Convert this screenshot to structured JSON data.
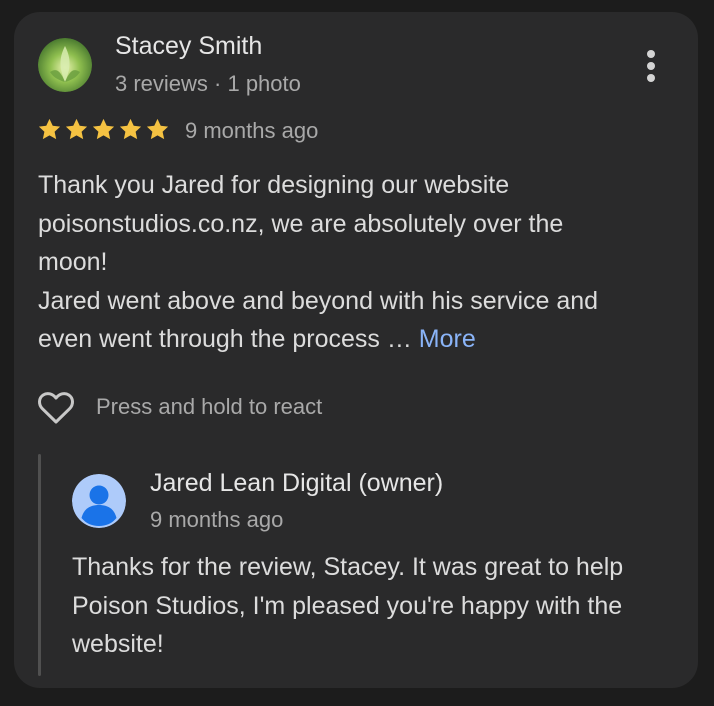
{
  "review": {
    "reviewer_name": "Stacey Smith",
    "reviewer_meta": "3 reviews · 1 photo",
    "rating": 5,
    "max_rating": 5,
    "time": "9 months ago",
    "text_lines": [
      "Thank you Jared for designing our website",
      "poisonstudios.co.nz, we are absolutely over the",
      "moon!",
      "Jared went above and beyond with his service and",
      "even went through the process … "
    ],
    "more_label": "More",
    "react_hint": "Press and hold to react",
    "colors": {
      "star": "#f5c242",
      "link": "#8ab4f8",
      "card_bg": "#2a2a2b"
    }
  },
  "reply": {
    "owner_name": "Jared Lean Digital (owner)",
    "time": "9 months ago",
    "text_lines": [
      "Thanks for the review, Stacey. It was great to help",
      "Poison Studios, I'm pleased you're happy with the",
      "website!"
    ],
    "avatar_color": "#aecbfa"
  },
  "icons": {
    "menu": "more-vert-icon",
    "star": "star-icon",
    "heart": "heart-outline-icon",
    "person": "person-icon"
  }
}
